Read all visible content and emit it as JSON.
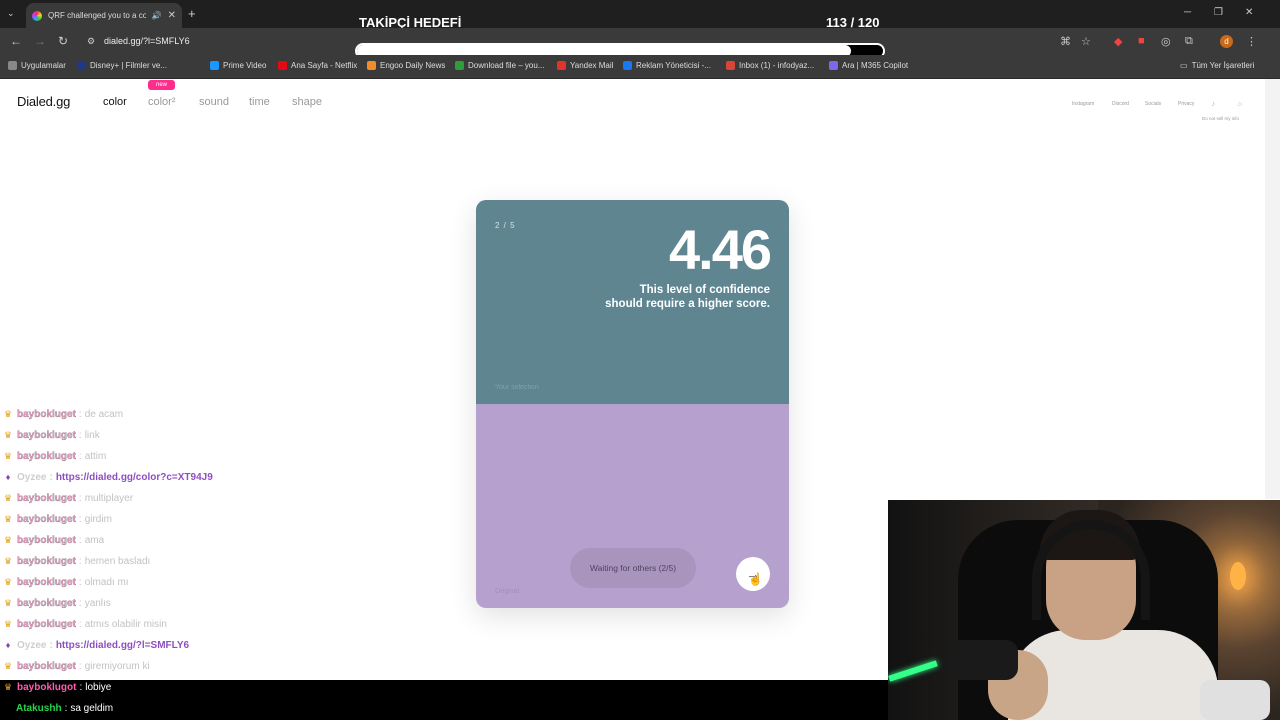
{
  "browser": {
    "tab_title": "QRF challenged you to a color match",
    "url": "dialed.gg/?l=SMFLY6",
    "profile_initial": "d",
    "bookmarks": [
      {
        "label": "Uygulamalar",
        "color": "#888888"
      },
      {
        "label": "Disney+ | Filmler ve...",
        "color": "#1b3a8c"
      },
      {
        "label": "Prime Video",
        "color": "#1a98ff"
      },
      {
        "label": "Ana Sayfa - Netflix",
        "color": "#e50914"
      },
      {
        "label": "Engoo Daily News",
        "color": "#f28c28"
      },
      {
        "label": "Download file – you...",
        "color": "#2e9d3a"
      },
      {
        "label": "Yandex Mail",
        "color": "#e3322b"
      },
      {
        "label": "Reklam Yöneticisi -...",
        "color": "#1877f2"
      },
      {
        "label": "Inbox (1) - infodyaz...",
        "color": "#d44638"
      },
      {
        "label": "Ara | M365 Copilot",
        "color": "#7b68ee"
      }
    ],
    "all_bookmarks": "Tüm Yer İşaretleri"
  },
  "overlay": {
    "goal_label": "TAKİPÇİ HEDEFİ",
    "goal_count": "113 / 120",
    "goal_progress": 0.94
  },
  "site": {
    "logo": "Dialed.gg",
    "nav": [
      {
        "label": "color",
        "active": true
      },
      {
        "label": "color²",
        "active": false
      },
      {
        "label": "sound",
        "active": false
      },
      {
        "label": "time",
        "active": false
      },
      {
        "label": "shape",
        "active": false
      }
    ],
    "new_badge": "new",
    "right_links": [
      "Instagram",
      "Discord",
      "Socials",
      "Privacy"
    ],
    "do_not_sell": "Do not sell my info"
  },
  "card": {
    "round": "2 / 5",
    "score": "4.46",
    "comment_line1": "This level of confidence",
    "comment_line2": "should require a higher score.",
    "your_selection_label": "Your selection",
    "original_label": "Original",
    "waiting_label": "Waiting for others (2/5)",
    "colors": {
      "selection": "#5f8591",
      "original": "#b6a0cd"
    }
  },
  "chat": {
    "messages": [
      {
        "user": "baybokluget",
        "text": "de acam",
        "type": "faded"
      },
      {
        "user": "baybokluget",
        "text": "link",
        "type": "faded"
      },
      {
        "user": "baybokluget",
        "text": "attim",
        "type": "faded"
      },
      {
        "user": "Oyzee",
        "text": "https://dialed.gg/color?c=XT94J9",
        "type": "link"
      },
      {
        "user": "baybokluget",
        "text": "multiplayer",
        "type": "faded"
      },
      {
        "user": "baybokluget",
        "text": "girdim",
        "type": "faded"
      },
      {
        "user": "baybokluget",
        "text": "ama",
        "type": "faded"
      },
      {
        "user": "baybokluget",
        "text": "hemen basladı",
        "type": "faded"
      },
      {
        "user": "baybokluget",
        "text": "olmadı mı",
        "type": "faded"
      },
      {
        "user": "baybokluget",
        "text": "yanlıs",
        "type": "faded"
      },
      {
        "user": "baybokluget",
        "text": "atmıs olabilir misin",
        "type": "faded"
      },
      {
        "user": "Oyzee",
        "text": "https://dialed.gg/?l=SMFLY6",
        "type": "link"
      },
      {
        "user": "baybokluget",
        "text": "giremiyorum ki",
        "type": "faded"
      }
    ],
    "recent": [
      {
        "user": "bayboklugot",
        "text": "lobiye"
      },
      {
        "user": "Atakushh",
        "text": "sa geldim"
      }
    ]
  }
}
